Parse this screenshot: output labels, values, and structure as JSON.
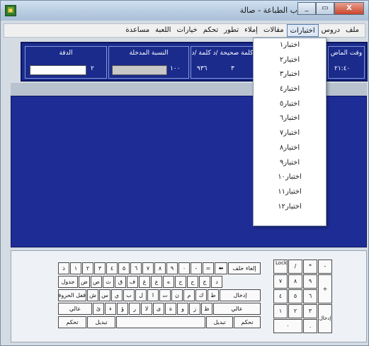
{
  "window": {
    "title": "ضارب الطباعة - صالة",
    "controls": [
      "_",
      "▭",
      "X"
    ]
  },
  "menubar": {
    "items": [
      "ملف",
      "دروس",
      "اختبارات",
      "مقالات",
      "إملاء",
      "تطور",
      "تحكم",
      "خيارات",
      "اللعبة",
      "مساعدة"
    ]
  },
  "stats": {
    "accuracy_label": "الدقة",
    "accuracy_value": "٢",
    "percent_label": "النسبة المدخلة",
    "percent_value": "١٠٠",
    "words_label": "كلمة صحيحة /د   كلمة /د",
    "words_value_1": "٩٣٦",
    "words_value_2": "٣",
    "time_label": "وقت الماض",
    "time_value": "٢١:٤٠"
  },
  "dropdown": {
    "items": [
      "اختبار١",
      "اختبار٢",
      "اختبار٣",
      "اختبار٤",
      "اختبار٥",
      "اختبار٦",
      "اختبار٧",
      "اختبار٨",
      "اختبار٩",
      "اختبار١٠",
      "اختبار١١",
      "اختبار١٢"
    ]
  },
  "keyboard": {
    "row1": [
      "ذ",
      "١",
      "٢",
      "٣",
      "٤",
      "٥",
      "٦",
      "٧",
      "٨",
      "٩",
      "٠",
      "-",
      "=",
      "⬅",
      "إلغاء خلف"
    ],
    "row2": [
      "جدول",
      "ض",
      "ص",
      "ث",
      "ق",
      "ف",
      "غ",
      "ع",
      "ه",
      "خ",
      "ح",
      "ج",
      "د"
    ],
    "row3": [
      "قفل الحروف",
      "ش",
      "س",
      "ي",
      "ب",
      "ل",
      "ا",
      "ت",
      "ن",
      "م",
      "ك",
      "ط",
      "إدخال"
    ],
    "row4": [
      "عالي",
      "ئ",
      "ء",
      "ؤ",
      "ر",
      "لا",
      "ى",
      "ة",
      "و",
      "ز",
      "ظ",
      "عالي"
    ],
    "row5": [
      "تحكم",
      "تبديل",
      "",
      "تبديل",
      "تحكم"
    ],
    "numpad": [
      "Num Lock",
      "/",
      "*",
      "-",
      "٧",
      "٨",
      "٩",
      "+",
      "٤",
      "٥",
      "٦",
      "١",
      "٢",
      "٣",
      "إدخال",
      "٠",
      "."
    ]
  }
}
